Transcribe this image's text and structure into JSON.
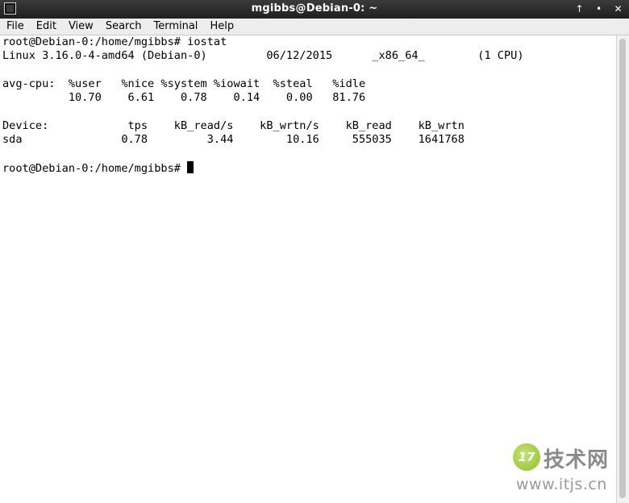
{
  "window": {
    "title": "mgibbs@Debian-0: ~",
    "controls": {
      "minimize": "↑",
      "maximize": "•",
      "close": "✕"
    }
  },
  "menu": {
    "items": [
      "File",
      "Edit",
      "View",
      "Search",
      "Terminal",
      "Help"
    ]
  },
  "terminal": {
    "lines": [
      "root@Debian-0:/home/mgibbs# iostat",
      "Linux 3.16.0-4-amd64 (Debian-0)         06/12/2015      _x86_64_        (1 CPU)",
      "",
      "avg-cpu:  %user   %nice %system %iowait  %steal   %idle",
      "          10.70    6.61    0.78    0.14    0.00   81.76",
      "",
      "Device:            tps    kB_read/s    kB_wrtn/s    kB_read    kB_wrtn",
      "sda               0.78         3.44        10.16     555035    1641768",
      "",
      "root@Debian-0:/home/mgibbs# "
    ]
  },
  "watermark": {
    "logo": "17",
    "text": "技术网",
    "url": "www.itjs.cn"
  },
  "colors": {
    "titlebar": "#2b2b2b",
    "menubar": "#ededed",
    "terminal_bg": "#ffffff",
    "terminal_fg": "#000000"
  }
}
